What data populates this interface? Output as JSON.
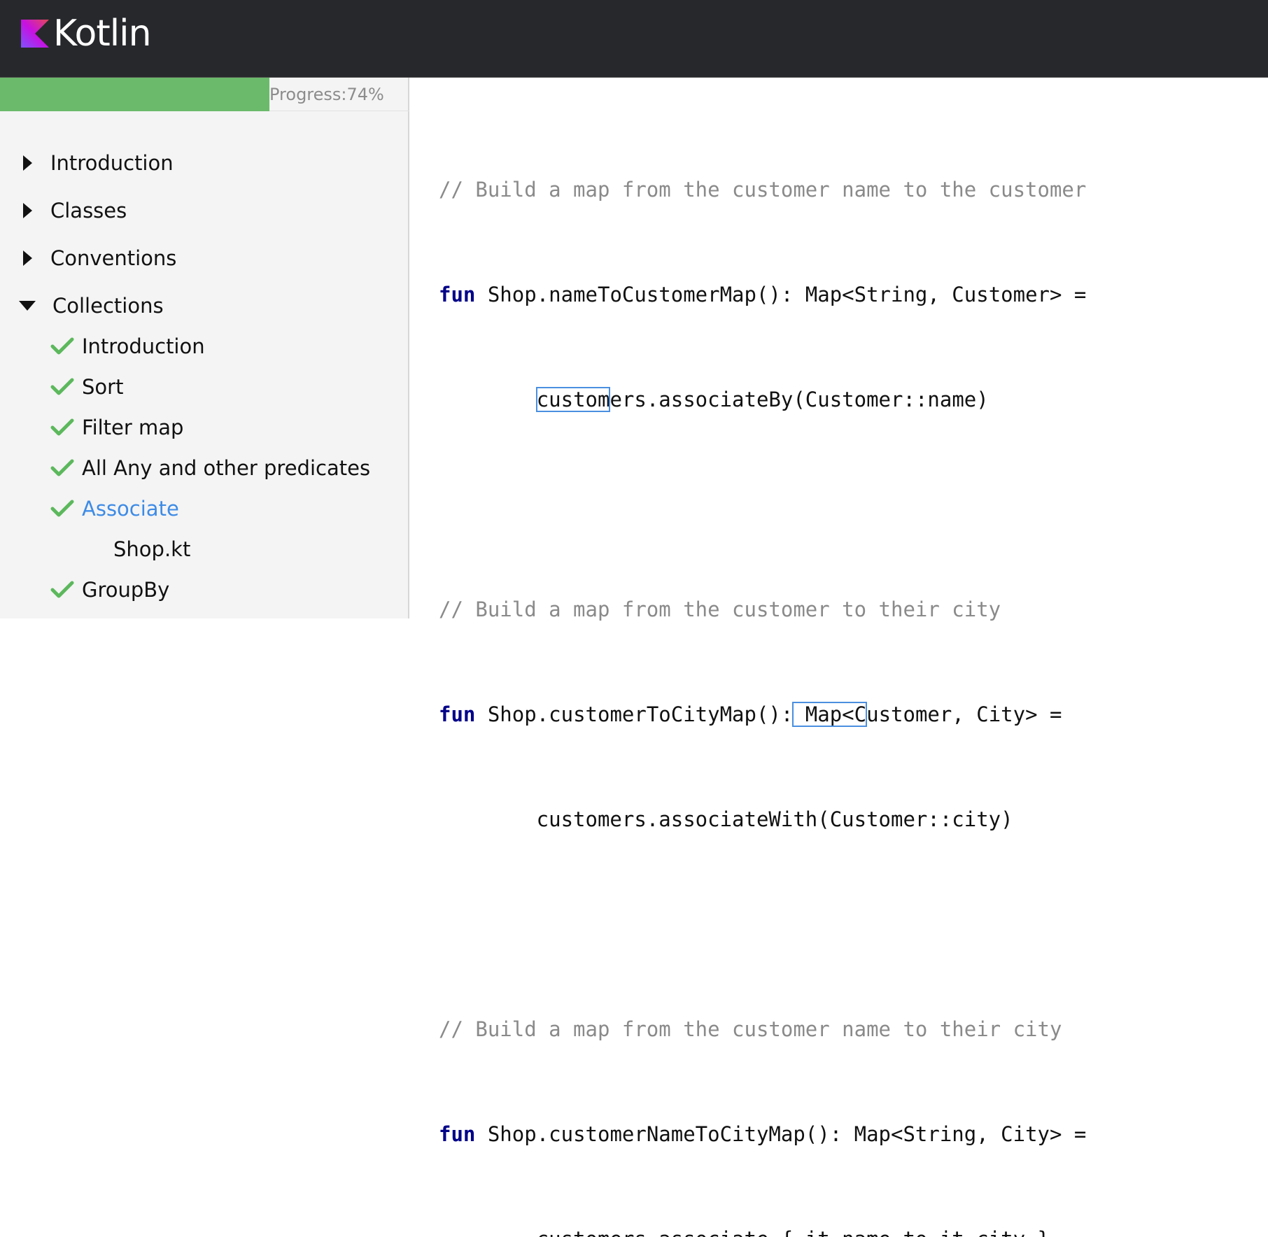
{
  "header": {
    "logo_text": "Kotlin"
  },
  "progress": {
    "label": "Progress:74%",
    "value_percent": 74
  },
  "tree": {
    "sections": [
      {
        "label": "Introduction",
        "expanded": false
      },
      {
        "label": "Classes",
        "expanded": false
      },
      {
        "label": "Conventions",
        "expanded": false
      },
      {
        "label": "Collections",
        "expanded": true
      }
    ],
    "collections_items": [
      {
        "label": "Introduction",
        "done": true
      },
      {
        "label": "Sort",
        "done": true
      },
      {
        "label": "Filter map",
        "done": true
      },
      {
        "label": "All Any and other predicates",
        "done": true
      },
      {
        "label": "Associate",
        "done": true,
        "active": true
      },
      {
        "label": "GroupBy",
        "done": true
      }
    ],
    "file": "Shop.kt"
  },
  "code": {
    "block1": {
      "comment": "// Build a map from the customer name to the customer",
      "kw": "fun",
      "sig": " Shop.nameToCustomerMap(): Map<String, Customer> =",
      "indent": "        ",
      "body_hl": "custom",
      "body_rest": "ers.associateBy(Customer::name)"
    },
    "block2": {
      "comment": "// Build a map from the customer to their city",
      "kw": "fun",
      "sig_a": " Shop.customerToCityMap():",
      "sig_hl": " Map<C",
      "sig_b": "ustomer, City> =",
      "body": "        customers.associateWith(Customer::city)"
    },
    "block3": {
      "comment": "// Build a map from the customer name to their city",
      "kw": "fun",
      "sig": " Shop.customerNameToCityMap(): Map<String, City> =",
      "body": "        customers.associate { it.name to it.city }"
    }
  },
  "colors": {
    "header_bg": "#27282c",
    "progress": "#6bba6b",
    "accent": "#3d8be6",
    "keyword": "#000088",
    "comment": "#8a8a8a"
  }
}
